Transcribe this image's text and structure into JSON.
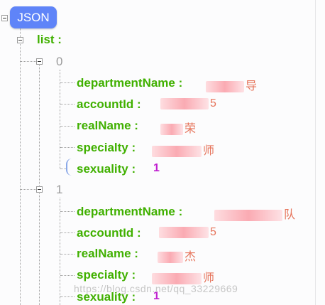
{
  "root": {
    "badge": "JSON"
  },
  "list": {
    "key": "list :",
    "items": [
      {
        "index": "0",
        "fields": [
          {
            "key": "departmentName :",
            "suffix": "导"
          },
          {
            "key": "accountId :",
            "suffix": "5"
          },
          {
            "key": "realName :",
            "suffix": "荣"
          },
          {
            "key": "specialty :",
            "suffix": "师"
          },
          {
            "key": "sexuality :",
            "number": "1"
          }
        ]
      },
      {
        "index": "1",
        "fields": [
          {
            "key": "departmentName :",
            "suffix": "队"
          },
          {
            "key": "accountId :",
            "suffix": "5"
          },
          {
            "key": "realName :",
            "suffix": "杰"
          },
          {
            "key": "specialty :",
            "suffix": "师"
          },
          {
            "key": "sexuality :",
            "number": "1"
          }
        ]
      }
    ]
  },
  "watermark": "https://blog.csdn.net/qq_33229669"
}
